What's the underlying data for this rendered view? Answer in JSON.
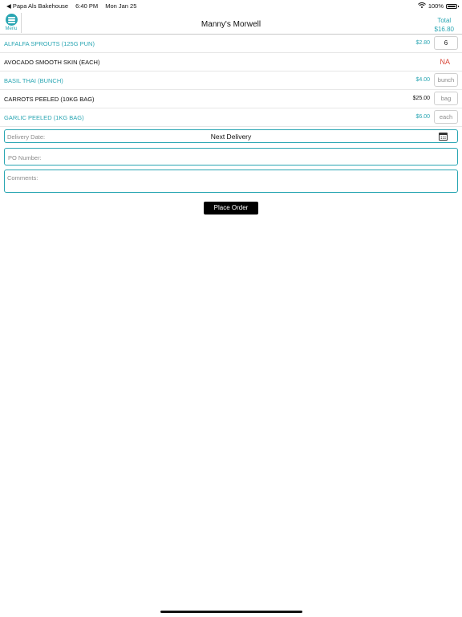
{
  "status_bar": {
    "back_app": "◀ Papa Als Bakehouse",
    "time": "6:40 PM",
    "date": "Mon Jan 25",
    "battery": "100%",
    "icons": [
      "wifi-icon",
      "battery-icon"
    ]
  },
  "nav": {
    "menu_label": "Menu",
    "title": "Manny's Morwell",
    "total_label": "Total",
    "total_value": "$16.80"
  },
  "colors": {
    "accent": "#2aa6b3",
    "unavailable": "#d9483b",
    "button_bg": "#000000"
  },
  "items": [
    {
      "name": "ALFALFA SPROUTS (125G PUN)",
      "price": "$2.80",
      "qty": "6",
      "unit_placeholder": "",
      "available": true,
      "highlight": true
    },
    {
      "name": "AVOCADO SMOOTH SKIN (EACH)",
      "price": "",
      "qty": "",
      "unit_placeholder": "",
      "available": false,
      "status": "NA",
      "highlight": false
    },
    {
      "name": "BASIL THAI (BUNCH)",
      "price": "$4.00",
      "qty": "",
      "unit_placeholder": "bunch",
      "available": true,
      "highlight": true
    },
    {
      "name": "CARROTS PEELED (10KG BAG)",
      "price": "$25.00",
      "qty": "",
      "unit_placeholder": "bag",
      "available": true,
      "highlight": false
    },
    {
      "name": "GARLIC PEELED (1KG BAG)",
      "price": "$6.00",
      "qty": "",
      "unit_placeholder": "each",
      "available": true,
      "highlight": true
    }
  ],
  "form": {
    "delivery_label": "Delivery Date:",
    "delivery_value": "Next Delivery",
    "po_placeholder": "PO Number:",
    "comments_placeholder": "Comments:"
  },
  "actions": {
    "place_order": "Place Order"
  }
}
